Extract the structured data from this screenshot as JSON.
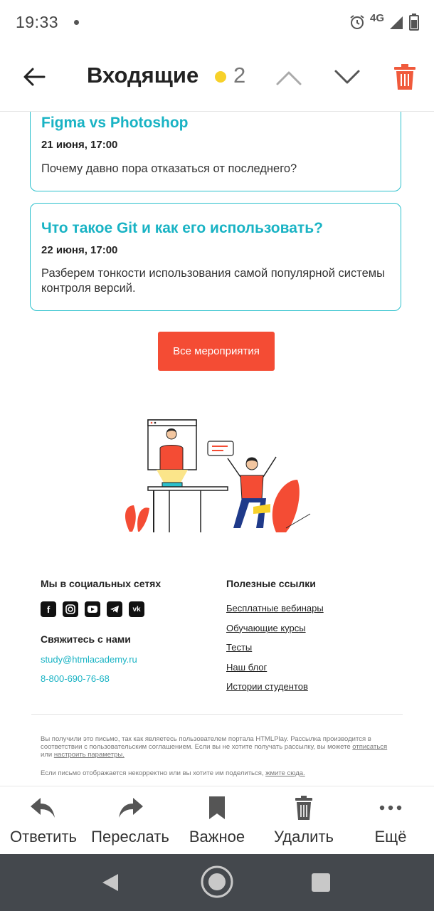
{
  "status_bar": {
    "time": "19:33",
    "network": "4G",
    "icons": [
      "alarm-icon",
      "signal-icon",
      "battery-icon"
    ]
  },
  "header": {
    "title": "Входящие",
    "unread_count": "2",
    "unread_dot_color": "#f7d12a",
    "icons": [
      "back-arrow-icon",
      "chevron-up-icon",
      "chevron-down-icon",
      "trash-icon"
    ]
  },
  "events": [
    {
      "title": "Figma vs Photoshop",
      "date": "21 июня, 17:00",
      "description": "Почему давно пора отказаться от последнего?"
    },
    {
      "title": "Что такое Git и как его использовать?",
      "date": "22 июня, 17:00",
      "description": "Разберем тонкости использования самой популярной системы контроля версий."
    }
  ],
  "all_events_button": "Все мероприятия",
  "footer": {
    "social_heading": "Мы в социальных сетях",
    "social_icons": [
      "facebook-icon",
      "instagram-icon",
      "youtube-icon",
      "telegram-icon",
      "vk-icon"
    ],
    "contact_heading": "Свяжитесь с нами",
    "email": "study@htmlacademy.ru",
    "phone": "8-800-690-76-68",
    "links_heading": "Полезные ссылки",
    "links": [
      "Бесплатные вебинары",
      "Обучающие курсы",
      "Тесты",
      "Наш блог",
      "Истории студентов"
    ],
    "legal_text_1": "Вы получили это письмо, так как являетесь пользователем портала HTMLPlay. Рассылка производится в соответствии с пользовательским соглашением. Если вы не хотите получать рассылку, вы можете",
    "legal_link_unsubscribe": "отписаться",
    "legal_or": "или",
    "legal_link_settings": "настроить параметры.",
    "legal_text_2": "Если письмо отображается некорректно или вы хотите им поделиться,",
    "legal_link_here": "жмите сюда."
  },
  "bottom_actions": [
    {
      "label": "Ответить",
      "icon": "reply-icon"
    },
    {
      "label": "Переслать",
      "icon": "forward-icon"
    },
    {
      "label": "Важное",
      "icon": "bookmark-icon"
    },
    {
      "label": "Удалить",
      "icon": "trash-icon"
    },
    {
      "label": "Ещё",
      "icon": "more-icon"
    }
  ],
  "colors": {
    "accent": "#19b3c4",
    "button": "#f44c34",
    "trash": "#f05a3c"
  }
}
